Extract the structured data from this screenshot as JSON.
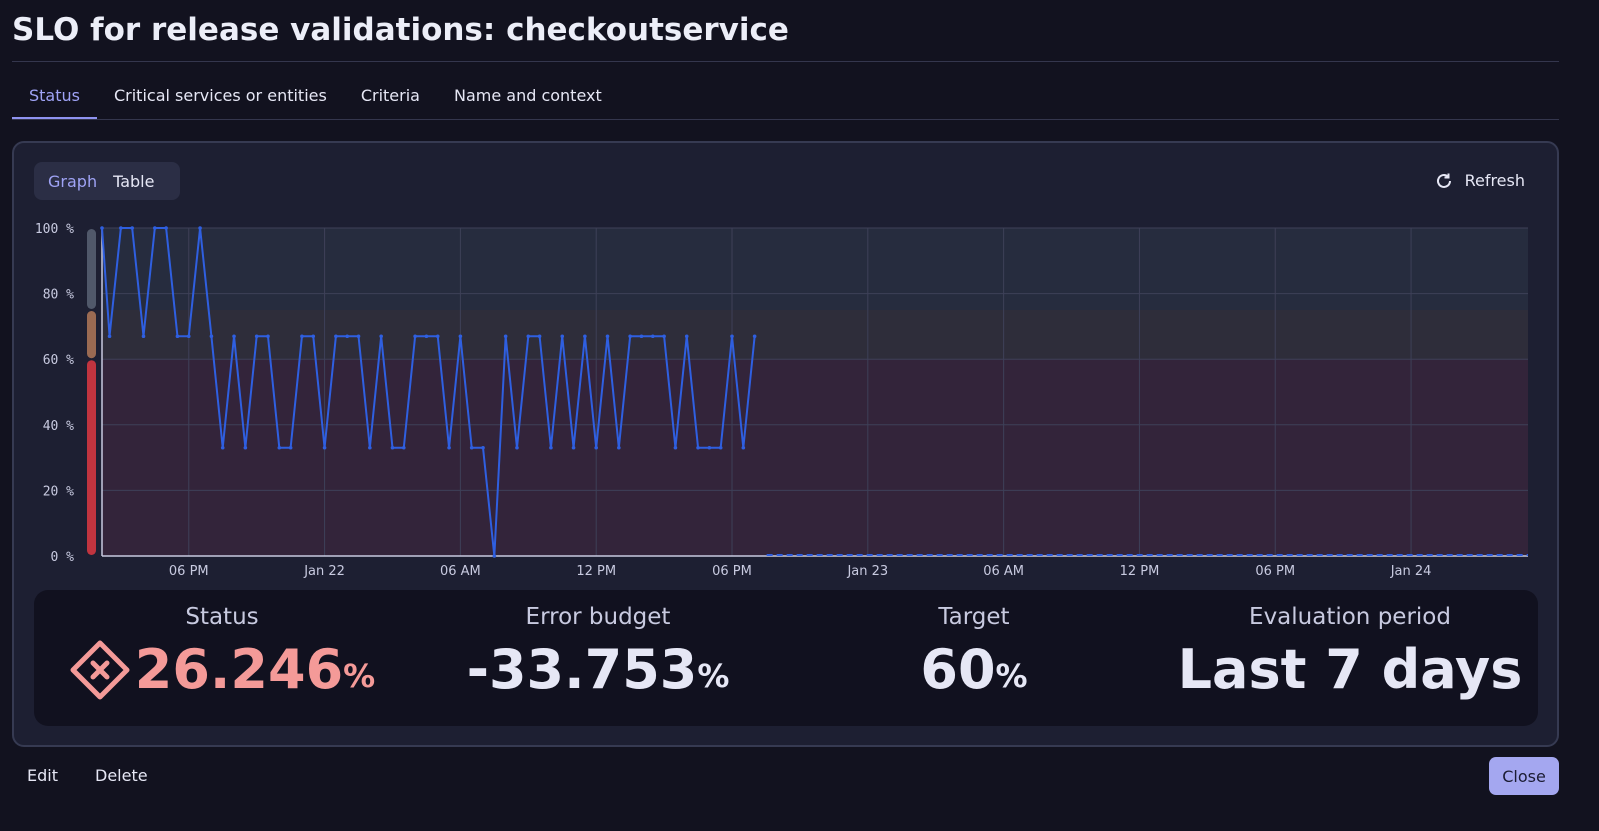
{
  "header": {
    "title": "SLO for release validations: checkoutservice"
  },
  "tabs": [
    {
      "label": "Status",
      "active": true
    },
    {
      "label": "Critical services or entities"
    },
    {
      "label": "Criteria"
    },
    {
      "label": "Name and context"
    }
  ],
  "view_toggle": {
    "graph": "Graph",
    "table": "Table",
    "selected": "Graph"
  },
  "refresh": {
    "label": "Refresh",
    "icon": "refresh-icon"
  },
  "colors": {
    "line": "#2f5fe0",
    "failure_band": "#c0343f",
    "warning_band": "#9a6a52",
    "success_band": "#50586a",
    "status_value": "#f49a98",
    "accent": "#9fa3f5"
  },
  "chart_data": {
    "type": "line",
    "xlim": [
      "Jan 21 14:10",
      "Jan 24 05:10"
    ],
    "ylim": [
      0,
      100
    ],
    "y_ticks": [
      "100 %",
      "80 %",
      "60 %",
      "40 %",
      "20 %",
      "0 %"
    ],
    "y_tick_values": [
      100,
      80,
      60,
      40,
      20,
      0
    ],
    "x_ticks": [
      {
        "t": "Jan 21 18:00",
        "label": "06 PM"
      },
      {
        "t": "Jan 22 00:00",
        "label": "Jan 22"
      },
      {
        "t": "Jan 22 06:00",
        "label": "06 AM"
      },
      {
        "t": "Jan 22 12:00",
        "label": "12 PM"
      },
      {
        "t": "Jan 22 18:00",
        "label": "06 PM"
      },
      {
        "t": "Jan 23 00:00",
        "label": "Jan 23"
      },
      {
        "t": "Jan 23 06:00",
        "label": "06 AM"
      },
      {
        "t": "Jan 23 12:00",
        "label": "12 PM"
      },
      {
        "t": "Jan 23 18:00",
        "label": "06 PM"
      },
      {
        "t": "Jan 24 00:00",
        "label": "Jan 24"
      }
    ],
    "bands": [
      {
        "from": 0,
        "to": 60,
        "state": "failure"
      },
      {
        "from": 60,
        "to": 75,
        "state": "warning"
      },
      {
        "from": 75,
        "to": 100,
        "state": "success"
      }
    ],
    "grid": true,
    "points": [
      {
        "t": "Jan 21 14:00",
        "v": 100
      },
      {
        "t": "Jan 21 14:30",
        "v": 67
      },
      {
        "t": "Jan 21 15:00",
        "v": 100
      },
      {
        "t": "Jan 21 15:30",
        "v": 100
      },
      {
        "t": "Jan 21 16:00",
        "v": 67
      },
      {
        "t": "Jan 21 16:30",
        "v": 100
      },
      {
        "t": "Jan 21 17:00",
        "v": 100
      },
      {
        "t": "Jan 21 17:30",
        "v": 67
      },
      {
        "t": "Jan 21 18:00",
        "v": 67
      },
      {
        "t": "Jan 21 18:30",
        "v": 100
      },
      {
        "t": "Jan 21 19:00",
        "v": 67
      },
      {
        "t": "Jan 21 19:30",
        "v": 33
      },
      {
        "t": "Jan 21 20:00",
        "v": 67
      },
      {
        "t": "Jan 21 20:30",
        "v": 33
      },
      {
        "t": "Jan 21 21:00",
        "v": 67
      },
      {
        "t": "Jan 21 21:30",
        "v": 67
      },
      {
        "t": "Jan 21 22:00",
        "v": 33
      },
      {
        "t": "Jan 21 22:30",
        "v": 33
      },
      {
        "t": "Jan 21 23:00",
        "v": 67
      },
      {
        "t": "Jan 21 23:30",
        "v": 67
      },
      {
        "t": "Jan 22 00:00",
        "v": 33
      },
      {
        "t": "Jan 22 00:30",
        "v": 67
      },
      {
        "t": "Jan 22 01:00",
        "v": 67
      },
      {
        "t": "Jan 22 01:30",
        "v": 67
      },
      {
        "t": "Jan 22 02:00",
        "v": 33
      },
      {
        "t": "Jan 22 02:30",
        "v": 67
      },
      {
        "t": "Jan 22 03:00",
        "v": 33
      },
      {
        "t": "Jan 22 03:30",
        "v": 33
      },
      {
        "t": "Jan 22 04:00",
        "v": 67
      },
      {
        "t": "Jan 22 04:30",
        "v": 67
      },
      {
        "t": "Jan 22 05:00",
        "v": 67
      },
      {
        "t": "Jan 22 05:30",
        "v": 33
      },
      {
        "t": "Jan 22 06:00",
        "v": 67
      },
      {
        "t": "Jan 22 06:30",
        "v": 33
      },
      {
        "t": "Jan 22 07:00",
        "v": 33
      },
      {
        "t": "Jan 22 07:30",
        "v": 0
      },
      {
        "t": "Jan 22 08:00",
        "v": 67
      },
      {
        "t": "Jan 22 08:30",
        "v": 33
      },
      {
        "t": "Jan 22 09:00",
        "v": 67
      },
      {
        "t": "Jan 22 09:30",
        "v": 67
      },
      {
        "t": "Jan 22 10:00",
        "v": 33
      },
      {
        "t": "Jan 22 10:30",
        "v": 67
      },
      {
        "t": "Jan 22 11:00",
        "v": 33
      },
      {
        "t": "Jan 22 11:30",
        "v": 67
      },
      {
        "t": "Jan 22 12:00",
        "v": 33
      },
      {
        "t": "Jan 22 12:30",
        "v": 67
      },
      {
        "t": "Jan 22 13:00",
        "v": 33
      },
      {
        "t": "Jan 22 13:30",
        "v": 67
      },
      {
        "t": "Jan 22 14:00",
        "v": 67
      },
      {
        "t": "Jan 22 14:30",
        "v": 67
      },
      {
        "t": "Jan 22 15:00",
        "v": 67
      },
      {
        "t": "Jan 22 15:30",
        "v": 33
      },
      {
        "t": "Jan 22 16:00",
        "v": 67
      },
      {
        "t": "Jan 22 16:30",
        "v": 33
      },
      {
        "t": "Jan 22 17:00",
        "v": 33
      },
      {
        "t": "Jan 22 17:30",
        "v": 33
      },
      {
        "t": "Jan 22 18:00",
        "v": 67
      },
      {
        "t": "Jan 22 18:30",
        "v": 33
      },
      {
        "t": "Jan 22 19:00",
        "v": 67
      }
    ]
  },
  "stats": [
    {
      "label": "Status",
      "value": "26.246",
      "unit": "%",
      "icon": "failure-diamond-icon"
    },
    {
      "label": "Error budget",
      "value": "-33.753",
      "unit": "%"
    },
    {
      "label": "Target",
      "value": "60",
      "unit": "%"
    },
    {
      "label": "Evaluation period",
      "value": "Last 7 days",
      "unit": ""
    }
  ],
  "footer": {
    "edit": "Edit",
    "delete": "Delete",
    "close": "Close"
  }
}
